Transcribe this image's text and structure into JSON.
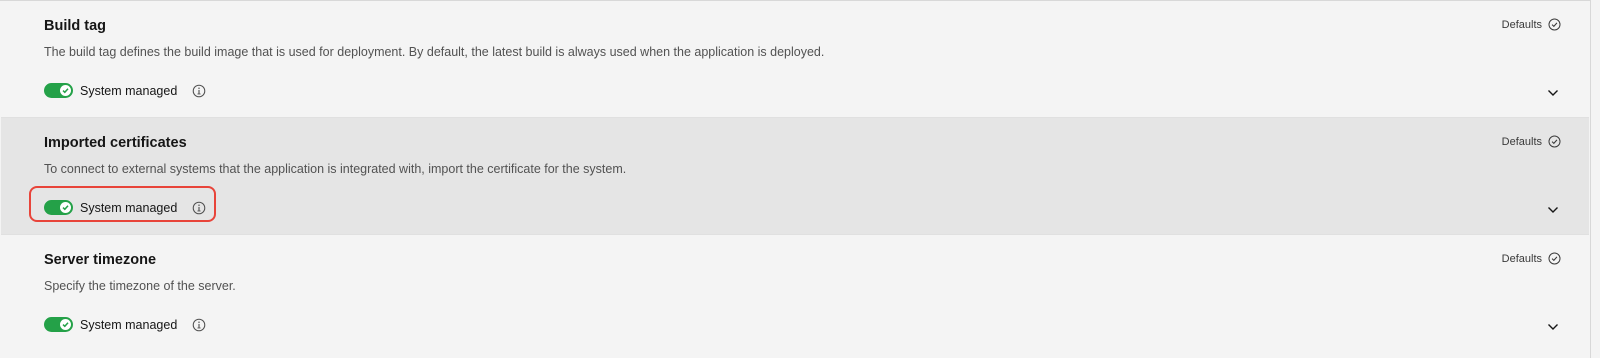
{
  "sections": [
    {
      "title": "Build tag",
      "description": "The build tag defines the build image that is used for deployment. By default, the latest build is always used when the application is deployed.",
      "defaults_label": "Defaults",
      "toggle_label": "System managed",
      "toggle_on": true
    },
    {
      "title": "Imported certificates",
      "description": "To connect to external systems that the application is integrated with, import the certificate for the system.",
      "defaults_label": "Defaults",
      "toggle_label": "System managed",
      "toggle_on": true
    },
    {
      "title": "Server timezone",
      "description": "Specify the timezone of the server.",
      "defaults_label": "Defaults",
      "toggle_label": "System managed",
      "toggle_on": true
    }
  ],
  "colors": {
    "toggle_on": "#24a148",
    "highlight": "#e8443a",
    "active_section_bg": "#e5e5e5",
    "page_bg": "#f4f4f4"
  },
  "icons": {
    "defaults": "checkmark-outline-icon",
    "info": "information-icon",
    "expand": "chevron-down-icon",
    "toggle_knob": "checkmark-icon"
  }
}
